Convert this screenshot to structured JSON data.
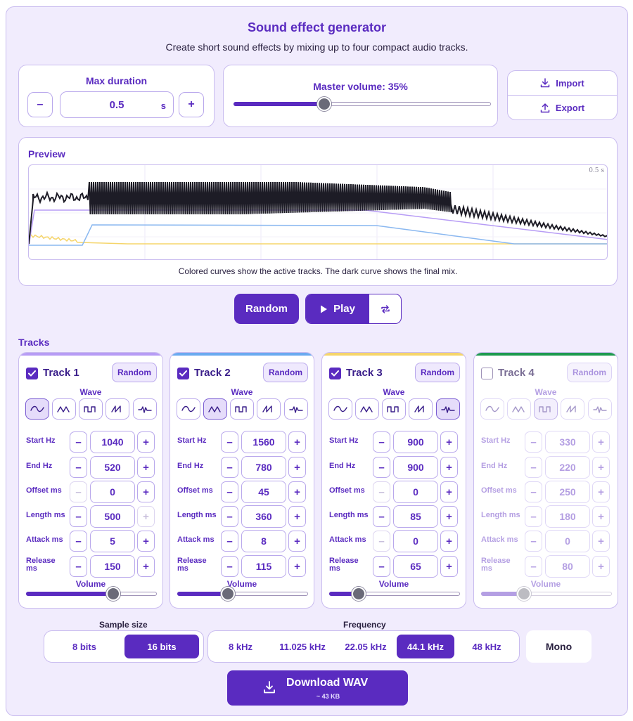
{
  "header": {
    "title": "Sound effect generator",
    "subtitle": "Create short sound effects by mixing up to four compact audio tracks."
  },
  "duration": {
    "label": "Max duration",
    "value": "0.5",
    "unit": "s",
    "minus": "–",
    "plus": "+"
  },
  "master_volume": {
    "label": "Master volume: 35%",
    "value_fraction": 0.35
  },
  "io": {
    "import_label": "Import",
    "export_label": "Export"
  },
  "preview": {
    "label": "Preview",
    "time_label": "0.5 s",
    "caption": "Colored curves show the active tracks. The dark curve shows the final mix."
  },
  "actions": {
    "random_label": "Random",
    "play_label": "Play"
  },
  "tracks_label": "Tracks",
  "param_labels": {
    "start_hz": "Start Hz",
    "end_hz": "End Hz",
    "offset_ms": "Offset ms",
    "length_ms": "Length ms",
    "attack_ms": "Attack ms",
    "release_ms": "Release ms"
  },
  "wave_label": "Wave",
  "volume_label": "Volume",
  "track_random_label": "Random",
  "tracks": [
    {
      "name": "Track 1",
      "enabled": true,
      "color": "#b79cf5",
      "wave": 0,
      "start_hz": "1040",
      "end_hz": "520",
      "offset_ms": "0",
      "length_ms": "500",
      "attack_ms": "5",
      "release_ms": "150",
      "volume": 0.66
    },
    {
      "name": "Track 2",
      "enabled": true,
      "color": "#6aaaf0",
      "wave": 1,
      "start_hz": "1560",
      "end_hz": "780",
      "offset_ms": "45",
      "length_ms": "360",
      "attack_ms": "8",
      "release_ms": "115",
      "volume": 0.38
    },
    {
      "name": "Track 3",
      "enabled": true,
      "color": "#f5d56a",
      "wave": 4,
      "start_hz": "900",
      "end_hz": "900",
      "offset_ms": "0",
      "length_ms": "85",
      "attack_ms": "0",
      "release_ms": "65",
      "volume": 0.22
    },
    {
      "name": "Track 4",
      "enabled": false,
      "color": "#1e9a4e",
      "wave": 2,
      "start_hz": "330",
      "end_hz": "220",
      "offset_ms": "250",
      "length_ms": "180",
      "attack_ms": "0",
      "release_ms": "80",
      "volume": 0.32
    }
  ],
  "sample_size": {
    "label": "Sample size",
    "options": [
      "8 bits",
      "16 bits"
    ],
    "selected": "16 bits"
  },
  "frequency": {
    "label": "Frequency",
    "options": [
      "8 kHz",
      "11.025 kHz",
      "22.05 kHz",
      "44.1 kHz",
      "48 kHz"
    ],
    "selected": "44.1 kHz"
  },
  "mono_label": "Mono",
  "download": {
    "label": "Download WAV",
    "size": "~ 43 KB"
  },
  "colors": {
    "accent": "#5a2bc0",
    "panel_bg": "#f1ecfd",
    "mix_curve": "#1d1c26"
  }
}
